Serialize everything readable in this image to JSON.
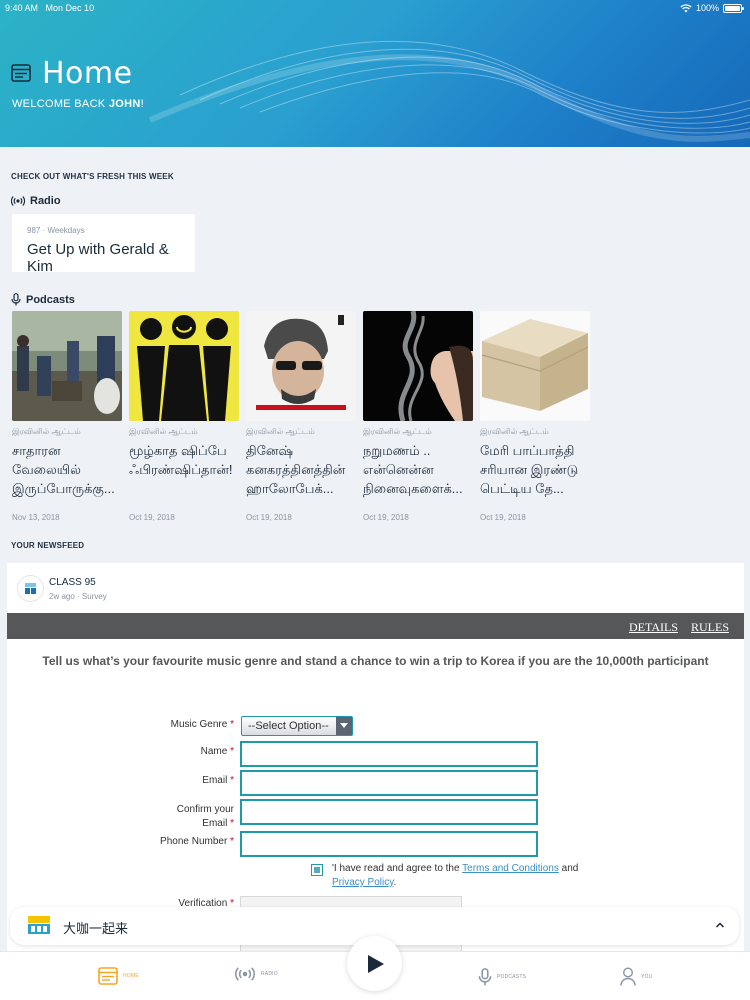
{
  "status_bar": {
    "time": "9:40 AM",
    "date": "Mon Dec 10",
    "battery": "100%"
  },
  "header": {
    "title": "Home",
    "welcome_prefix": "WELCOME BACK ",
    "user": "JOHN",
    "welcome_suffix": "!"
  },
  "fresh_label": "CHECK OUT WHAT'S FRESH THIS WEEK",
  "radio": {
    "heading": "Radio",
    "meta": "987 · Weekdays",
    "show": "Get Up with Gerald & Kim"
  },
  "podcasts": {
    "heading": "Podcasts",
    "items": [
      {
        "category": "இரவினில் ஆட்டம்",
        "title": "சாதாரன வேலையில் இருப்போருக்கு...",
        "date": "Nov 13, 2018"
      },
      {
        "category": "இரவினில் ஆட்டம்",
        "title": "மூழ்காத ஷிப்பே ஃபிரண்ஷிப்தான்!",
        "date": "Oct 19, 2018"
      },
      {
        "category": "இரவினில் ஆட்டம்",
        "title": "தினேஷ் கனகரத்தினத்தின் ஹாலோபேக்...",
        "date": "Oct 19, 2018"
      },
      {
        "category": "இரவினில் ஆட்டம்",
        "title": "நறுமணம் .. என்னென்ன நினைவுகளைக்...",
        "date": "Oct 19, 2018"
      },
      {
        "category": "இரவினில் ஆட்டம்",
        "title": "மேரி பாப்பாத்தி சரியான இரண்டு பெட்டிய தே...",
        "date": "Oct 19, 2018"
      }
    ]
  },
  "newsfeed_label": "YOUR NEWSFEED",
  "feed": {
    "source": "CLASS 95",
    "time": "2w ago",
    "type": "Survey",
    "links": {
      "details": "DETAILS",
      "rules": "RULES"
    },
    "prompt": "Tell us what’s your favourite music genre and stand a chance to win a trip to Korea if you are the 10,000th participant",
    "form": {
      "genre_label": "Music Genre",
      "genre_value": "--Select Option--",
      "name_label": "Name",
      "email_label": "Email",
      "confirm_label_1": "Confirm your",
      "confirm_label_2": "Email",
      "phone_label": "Phone Number",
      "req": "*",
      "agree_prefix": "'I have read and agree to the ",
      "terms": "Terms and Conditions",
      "agree_and": " and ",
      "privacy": "Privacy Policy",
      "agree_end": ".",
      "verification_label": "Verification"
    }
  },
  "player": {
    "station": "大咖一起来"
  },
  "tabs": {
    "home": "HOME",
    "radio": "RADIO",
    "podcasts": "PODCASTS",
    "you": "YOU"
  },
  "colors": {
    "accent": "#1e9aa8",
    "tab_active": "#f5a623",
    "header_start": "#2bb3c6",
    "header_end": "#1669b8"
  }
}
